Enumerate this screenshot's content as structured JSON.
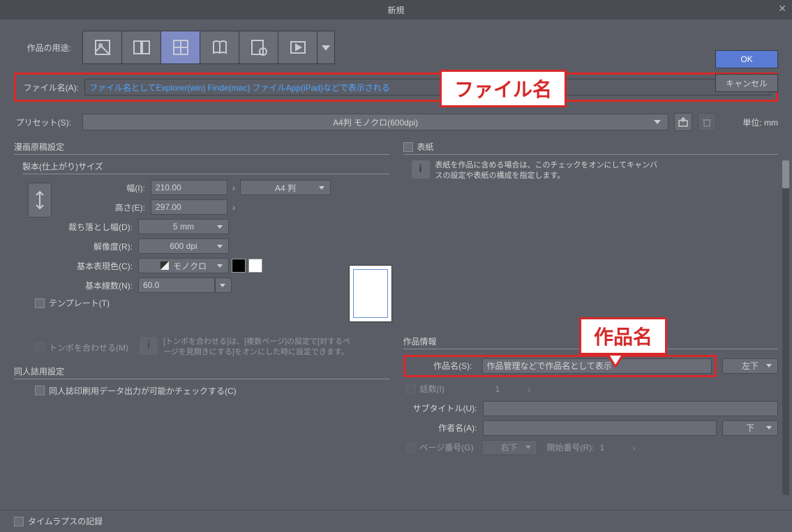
{
  "title": "新規",
  "usage_label": "作品の用途:",
  "usage_icons": [
    "illustration-icon",
    "doublepage-icon",
    "comic-icon",
    "book-icon",
    "pagesettings-icon",
    "animation-icon"
  ],
  "filename_label": "ファイル名(A):",
  "filename_value": "ファイル名としてExplorer(win) Finde(mac) ファイルApp(iPad)などで表示される",
  "preset_label": "プリセット(S):",
  "preset_value": "A4判 モノクロ(600dpi)",
  "unit_label": "単位:",
  "unit_value": "mm",
  "buttons": {
    "ok": "OK",
    "cancel": "キャンセル"
  },
  "manga": {
    "legend": "漫画原稿設定",
    "binding_legend": "製本(仕上がり)サイズ",
    "width_label": "幅(I):",
    "width_value": "210.00",
    "page_size": "A4 判",
    "height_label": "高さ(E):",
    "height_value": "297.00",
    "bleed_label": "裁ち落とし幅(D):",
    "bleed_value": "5 mm",
    "res_label": "解像度(R):",
    "res_value": "600 dpi",
    "color_label": "基本表現色(C):",
    "color_value": "モノクロ",
    "lines_label": "基本線数(N):",
    "lines_value": "60.0",
    "template_label": "テンプレート(T)",
    "tombo_label": "トンボを合わせる(M)",
    "tombo_info": "[トンボを合わせる]は、[複数ページ]の設定で[対するページを見開きにする]をオンにした時に設定できます。",
    "doujin_legend": "同人誌用設定",
    "doujin_check": "同人誌印刷用データ出力が可能かチェックする(C)"
  },
  "cover": {
    "legend": "表紙",
    "info": "表紙を作品に含める場合は、このチェックをオンにしてキャンバスの設定や表紙の構成を指定します。"
  },
  "workinfo": {
    "legend": "作品情報",
    "name_label": "作品名(S):",
    "name_value": "作品管理などで作品名として表示",
    "name_pos": "左下",
    "episodes_label": "話数(I)",
    "episodes_value": "1",
    "subtitle_label": "サブタイトル(U):",
    "author_label": "作者名(A):",
    "author_pos": "下",
    "pagenum_label": "ページ番号(G)",
    "pagenum_pos": "右下",
    "startnum_label": "開始番号(R):",
    "startnum_value": "1"
  },
  "timelapse_label": "タイムラプスの記録",
  "annotations": {
    "filename": "ファイル名",
    "workname": "作品名"
  }
}
